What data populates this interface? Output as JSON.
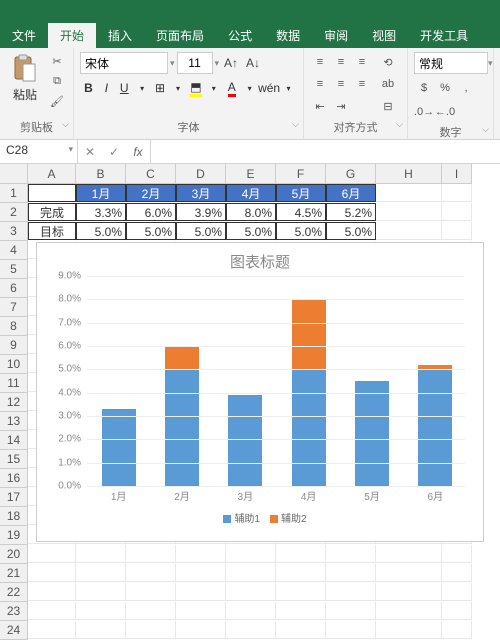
{
  "tabs": [
    "文件",
    "开始",
    "插入",
    "页面布局",
    "公式",
    "数据",
    "审阅",
    "视图",
    "开发工具"
  ],
  "active_tab": 1,
  "ribbon": {
    "clipboard": {
      "paste": "粘贴",
      "label": "剪贴板"
    },
    "font": {
      "name": "宋体",
      "size": "11",
      "label": "字体"
    },
    "align": {
      "wrap": "ab",
      "label": "对齐方式"
    },
    "number": {
      "format": "常规",
      "label": "数字"
    }
  },
  "namebox": "C28",
  "columns": [
    "A",
    "B",
    "C",
    "D",
    "E",
    "F",
    "G",
    "H",
    "I"
  ],
  "table": {
    "months": [
      "1月",
      "2月",
      "3月",
      "4月",
      "5月",
      "6月"
    ],
    "rows": [
      {
        "label": "完成",
        "values": [
          "3.3%",
          "6.0%",
          "3.9%",
          "8.0%",
          "4.5%",
          "5.2%"
        ]
      },
      {
        "label": "目标",
        "values": [
          "5.0%",
          "5.0%",
          "5.0%",
          "5.0%",
          "5.0%",
          "5.0%"
        ]
      }
    ]
  },
  "chart_data": {
    "type": "bar",
    "title": "图表标题",
    "categories": [
      "1月",
      "2月",
      "3月",
      "4月",
      "5月",
      "6月"
    ],
    "series": [
      {
        "name": "辅助1",
        "values": [
          3.3,
          5.0,
          3.9,
          5.0,
          4.5,
          5.0
        ],
        "color": "#5B9BD5"
      },
      {
        "name": "辅助2",
        "values": [
          0.0,
          1.0,
          0.0,
          3.0,
          0.0,
          0.2
        ],
        "color": "#ED7D31"
      }
    ],
    "ylim": [
      0,
      9
    ],
    "ylabel": "",
    "xlabel": "",
    "yticks": [
      "0.0%",
      "1.0%",
      "2.0%",
      "3.0%",
      "4.0%",
      "5.0%",
      "6.0%",
      "7.0%",
      "8.0%",
      "9.0%"
    ]
  },
  "row_count": 24
}
